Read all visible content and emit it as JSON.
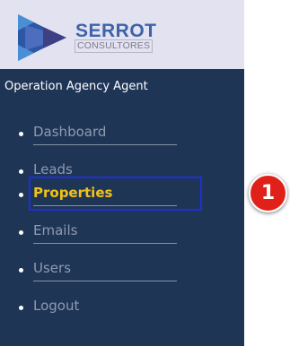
{
  "brand": {
    "name": "SERROT",
    "subtitle": "CONSULTORES",
    "logo_icon": "serrot-logo-icon",
    "colors": {
      "name": "#3d64a8",
      "subtitle": "#7a7a8c",
      "mark_primary": "#2d56a5",
      "mark_secondary": "#5170c2",
      "mark_accent": "#3f3f86"
    }
  },
  "header": {
    "role_label": "Operation Agency Agent"
  },
  "colors": {
    "sidebar_bg": "#1f3556",
    "brand_bg": "#e3e2f1",
    "link_default": "#8e9bb0",
    "link_active": "#f2c21a",
    "highlight_border": "#1c2fd8",
    "badge_bg": "#e0211a"
  },
  "nav": {
    "items": [
      {
        "label": "Dashboard",
        "active": false
      },
      {
        "label": "Leads",
        "active": false
      },
      {
        "label": "Properties",
        "active": true
      },
      {
        "label": "Emails",
        "active": false
      },
      {
        "label": "Users",
        "active": false
      },
      {
        "label": "Logout",
        "active": false
      }
    ]
  },
  "annotation": {
    "step_number": "1"
  }
}
